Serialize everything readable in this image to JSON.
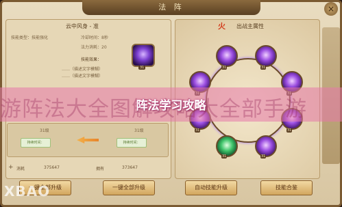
{
  "window": {
    "title": "法 阵",
    "close_glyph": "×"
  },
  "left_panel": {
    "title": "云中风身 - 准",
    "info_rows": [
      {
        "label": "技能类型：",
        "value": "技能强化"
      },
      {
        "label": "冷却时间：",
        "value": "8秒"
      },
      {
        "label": "法力消耗：",
        "value": "20"
      }
    ],
    "effect_header": "技能效果：",
    "effect_lines": [
      "……（描述文字模糊）",
      "……（描述文字模糊）"
    ],
    "skill_level_badge": "31",
    "upgrade": {
      "left_level": "31级",
      "left_label": "持续时间：",
      "right_level": "31级",
      "right_label": "持续时间："
    },
    "bottom": {
      "plus": "+",
      "cost_label": "消耗",
      "cost_value": "375647",
      "own_label": "拥有",
      "own_value": "373647"
    }
  },
  "right_panel": {
    "title": "出战主属性",
    "fire_glyph": "火",
    "nodes": [
      {
        "level": "31",
        "color": "purple"
      },
      {
        "level": "31",
        "color": "purple"
      },
      {
        "level": "31",
        "color": "purple"
      },
      {
        "level": "31",
        "color": "purple"
      },
      {
        "level": "31",
        "color": "purple"
      },
      {
        "level": "31",
        "color": "purple"
      },
      {
        "level": "31",
        "color": "green"
      },
      {
        "level": "31",
        "color": "purple"
      }
    ]
  },
  "banner": {
    "title": "阵法学习攻略",
    "background_text": "游阵法大全图解攻略大全部手游"
  },
  "buttons": {
    "one_key": "一键全部升级",
    "upgrade": "一键全部升级",
    "auto": "自动技能升级",
    "confirm": "技能合鉴"
  },
  "watermark": "XBAO"
}
